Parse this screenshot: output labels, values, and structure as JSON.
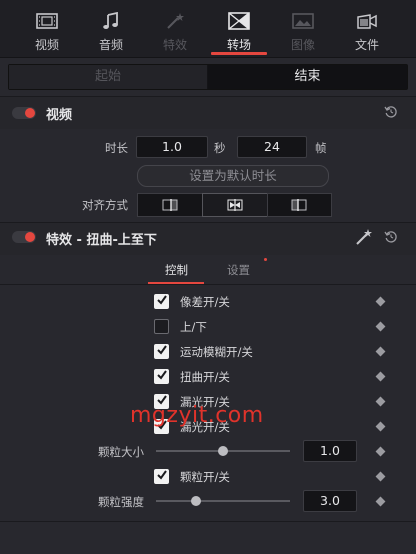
{
  "top_tabs": [
    {
      "label": "视频",
      "icon": "film-icon",
      "state": "normal"
    },
    {
      "label": "音频",
      "icon": "music-note-icon",
      "state": "normal"
    },
    {
      "label": "特效",
      "icon": "magic-wand-icon",
      "state": "disabled"
    },
    {
      "label": "转场",
      "icon": "transition-icon",
      "state": "active"
    },
    {
      "label": "图像",
      "icon": "image-icon",
      "state": "disabled"
    },
    {
      "label": "文件",
      "icon": "file-camera-icon",
      "state": "normal"
    }
  ],
  "segment": {
    "start_label": "起始",
    "end_label": "结束",
    "selected": "end"
  },
  "video_section": {
    "title": "视频",
    "duration_label": "时长",
    "duration_value": "1.0",
    "seconds_unit": "秒",
    "frames_value": "24",
    "frames_unit": "帧",
    "set_default_button": "设置为默认时长",
    "alignment_label": "对齐方式"
  },
  "effect_section": {
    "title": "特效 - 扭曲-上至下",
    "subtabs": [
      "控制",
      "设置"
    ],
    "active_subtab": "控制"
  },
  "controls": [
    {
      "label": "像差开/关",
      "checked": true
    },
    {
      "label": "上/下",
      "checked": false
    },
    {
      "label": "运动模糊开/关",
      "checked": true
    },
    {
      "label": "扭曲开/关",
      "checked": true
    },
    {
      "label": "漏光开/关",
      "checked": true
    },
    {
      "label": "漏光开/关",
      "checked": true
    }
  ],
  "grain_size": {
    "label": "颗粒大小",
    "value": "1.0",
    "slider_fraction": 0.5
  },
  "grain_toggle": {
    "label": "颗粒开/关",
    "checked": true
  },
  "grain_strength": {
    "label": "颗粒强度",
    "value": "3.0",
    "slider_fraction": 0.3
  },
  "watermark": "mgzyit.com",
  "colors": {
    "accent": "#e4473f",
    "background": "#28282e",
    "panel": "#1f1f24"
  }
}
